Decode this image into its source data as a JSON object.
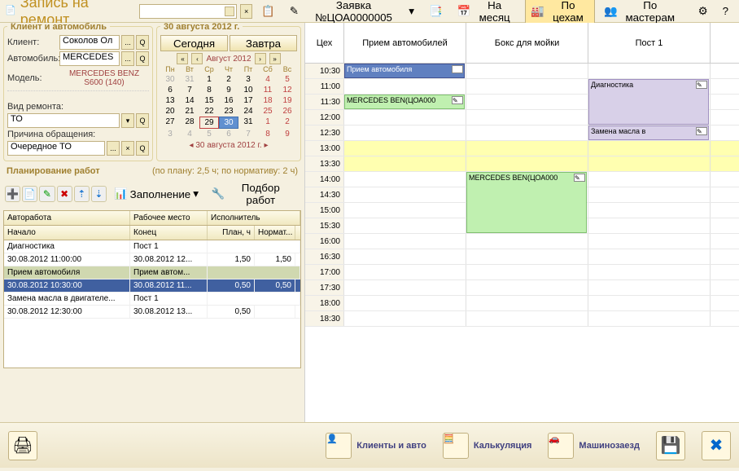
{
  "header": {
    "app_title": "Запись на ремонт",
    "combo_value": "",
    "request_label": "Заявка №ЦОА0000005",
    "month_btn": "На месяц",
    "by_shop": "По цехам",
    "by_master": "По мастерам"
  },
  "client": {
    "panel_title": "Клиент и автомобиль",
    "client_lbl": "Клиент:",
    "client_val": "Соколов Ол",
    "auto_lbl": "Автомобиль:",
    "auto_val": "MERCEDES",
    "model_lbl": "Модель:",
    "model_val": "MERCEDES BENZ S600 (140)",
    "repair_lbl": "Вид ремонта:",
    "repair_val": "ТО",
    "reason_lbl": "Причина обращения:",
    "reason_val": "Очередное ТО"
  },
  "date": {
    "panel_title": "30 августа 2012 г.",
    "today": "Сегодня",
    "tomorrow": "Завтра",
    "month": "Август 2012",
    "dows": [
      "Пн",
      "Вт",
      "Ср",
      "Чт",
      "Пт",
      "Сб",
      "Вс"
    ],
    "weeks": [
      [
        {
          "d": "30",
          "o": 1
        },
        {
          "d": "31",
          "o": 1
        },
        {
          "d": "1"
        },
        {
          "d": "2"
        },
        {
          "d": "3"
        },
        {
          "d": "4",
          "we": 1
        },
        {
          "d": "5",
          "we": 1
        }
      ],
      [
        {
          "d": "6"
        },
        {
          "d": "7"
        },
        {
          "d": "8"
        },
        {
          "d": "9"
        },
        {
          "d": "10"
        },
        {
          "d": "11",
          "we": 1
        },
        {
          "d": "12",
          "we": 1
        }
      ],
      [
        {
          "d": "13"
        },
        {
          "d": "14"
        },
        {
          "d": "15"
        },
        {
          "d": "16"
        },
        {
          "d": "17"
        },
        {
          "d": "18",
          "we": 1
        },
        {
          "d": "19",
          "we": 1
        }
      ],
      [
        {
          "d": "20"
        },
        {
          "d": "21"
        },
        {
          "d": "22"
        },
        {
          "d": "23"
        },
        {
          "d": "24"
        },
        {
          "d": "25",
          "we": 1
        },
        {
          "d": "26",
          "we": 1
        }
      ],
      [
        {
          "d": "27"
        },
        {
          "d": "28"
        },
        {
          "d": "29",
          "today": 1
        },
        {
          "d": "30",
          "sel": 1
        },
        {
          "d": "31"
        },
        {
          "d": "1",
          "o": 1,
          "we": 1
        },
        {
          "d": "2",
          "o": 1,
          "we": 1
        }
      ],
      [
        {
          "d": "3",
          "o": 1
        },
        {
          "d": "4",
          "o": 1
        },
        {
          "d": "5",
          "o": 1
        },
        {
          "d": "6",
          "o": 1
        },
        {
          "d": "7",
          "o": 1
        },
        {
          "d": "8",
          "o": 1,
          "we": 1
        },
        {
          "d": "9",
          "o": 1,
          "we": 1
        }
      ]
    ],
    "footer": "30 августа 2012 г."
  },
  "plan": {
    "title": "Планирование работ",
    "summary": "(по плану: 2,5 ч; по нормативу: 2 ч)",
    "fill_btn": "Заполнение",
    "pick_btn": "Подбор работ",
    "cols": {
      "c1": "Авторабота",
      "c2": "Рабочее место",
      "c3": "Исполнитель",
      "r1": "Начало",
      "r2": "Конец",
      "r3": "План, ч",
      "r4": "Нормат..."
    },
    "rows": [
      {
        "job": "Диагностика",
        "place": "Пост 1",
        "start": "30.08.2012 11:00:00",
        "end": "30.08.2012 12...",
        "plan": "1,50",
        "norm": "1,50",
        "sel": 0
      },
      {
        "job": "Прием автомобиля",
        "place": "Прием автом...",
        "start": "30.08.2012 10:30:00",
        "end": "30.08.2012 11...",
        "plan": "0,50",
        "norm": "0,50",
        "sel": 1
      },
      {
        "job": "Замена масла в двигателе...",
        "place": "Пост 1",
        "start": "30.08.2012 12:30:00",
        "end": "30.08.2012 13...",
        "plan": "0,50",
        "norm": "",
        "sel": 0
      }
    ]
  },
  "sched": {
    "col0": "Цех",
    "cols": [
      "Прием автомобилей",
      "Бокс для мойки",
      "Пост 1"
    ],
    "times": [
      "10:30",
      "11:00",
      "11:30",
      "12:00",
      "12:30",
      "13:00",
      "13:30",
      "14:00",
      "14:30",
      "15:00",
      "15:30",
      "16:00",
      "16:30",
      "17:00",
      "17:30",
      "18:00",
      "18:30"
    ],
    "hl": [
      5,
      6
    ],
    "appts": [
      {
        "col": 0,
        "row": 0,
        "span": 1,
        "cls": "appt-blue",
        "text": "Прием автомобиля"
      },
      {
        "col": 0,
        "row": 2,
        "span": 1,
        "cls": "appt-green",
        "text": "MERCEDES BEN(ЦОА000"
      },
      {
        "col": 1,
        "row": 7,
        "span": 4,
        "cls": "appt-green",
        "text": "MERCEDES BEN(ЦОА000"
      },
      {
        "col": 2,
        "row": 1,
        "span": 3,
        "cls": "appt-lav",
        "text": "Диагностика"
      },
      {
        "col": 2,
        "row": 4,
        "span": 1,
        "cls": "appt-lav",
        "text": "Замена масла в"
      }
    ]
  },
  "footer": {
    "clients": "Клиенты и авто",
    "calc": "Калькуляция",
    "car": "Машинозаезд"
  }
}
